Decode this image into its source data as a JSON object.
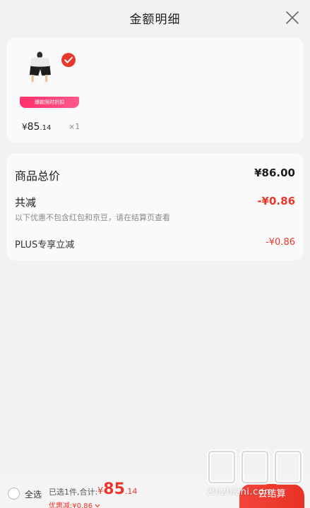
{
  "header": {
    "title": "金额明细"
  },
  "product": {
    "promo_label": "爆款限时折扣",
    "price_symbol": "¥",
    "price_int": "85",
    "price_dec": ".14",
    "quantity": "×1",
    "selected": true
  },
  "summary": {
    "total_label": "商品总价",
    "total_value": "¥86.00",
    "discount_label": "共减",
    "discount_value": "-¥0.86",
    "note": "以下优惠不包含红包和京豆，请在结算页查看",
    "plus_label": "PLUS专享立减",
    "plus_value": "-¥0.86"
  },
  "bottom": {
    "select_all": "全选",
    "selected_text": "已选1件,合计:",
    "total_symbol": "¥",
    "total_int": "85",
    "total_dec": ".14",
    "discount_text": "优惠减:¥0.86",
    "checkout_label": "去结算"
  },
  "watermark": {
    "text": "zhizhizhi.com"
  },
  "colors": {
    "accent_red": "#e8382b",
    "promo_pink": "#ff2f6a",
    "background": "#f2f2f2",
    "card": "#fafafa"
  },
  "icons": {
    "close": "close-icon",
    "check": "check-badge-icon",
    "chevron": "chevron-down-icon"
  }
}
